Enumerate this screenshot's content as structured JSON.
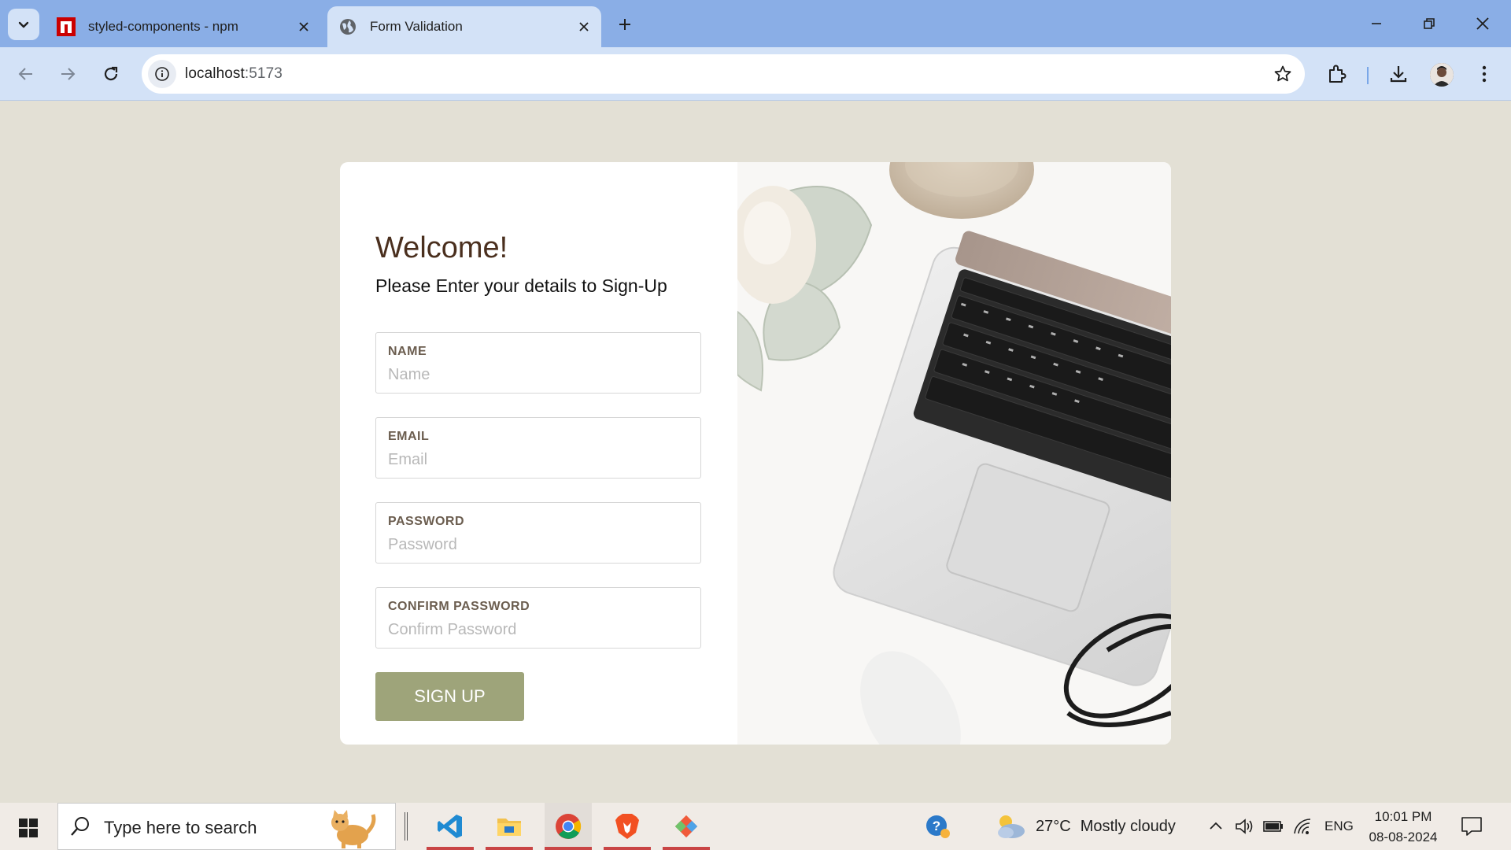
{
  "browser": {
    "tabs": [
      {
        "title": "styled-components - npm",
        "icon": "npm-icon",
        "active": false
      },
      {
        "title": "Form Validation",
        "icon": "globe-icon",
        "active": true
      }
    ],
    "url_host": "localhost",
    "url_port": ":5173"
  },
  "page": {
    "heading": "Welcome!",
    "subheading": "Please Enter your details to Sign-Up",
    "fields": [
      {
        "label": "NAME",
        "placeholder": "Name"
      },
      {
        "label": "EMAIL",
        "placeholder": "Email"
      },
      {
        "label": "PASSWORD",
        "placeholder": "Password"
      },
      {
        "label": "CONFIRM PASSWORD",
        "placeholder": "Confirm Password"
      }
    ],
    "submit_label": "SIGN UP",
    "colors": {
      "background": "#e3e0d5",
      "heading": "#4a2f1e",
      "button": "#9ea47a"
    }
  },
  "taskbar": {
    "search_placeholder": "Type here to search",
    "weather": {
      "temp": "27°C",
      "condition": "Mostly cloudy"
    },
    "language": "ENG",
    "time": "10:01 PM",
    "date": "08-08-2024",
    "apps": [
      "vscode-icon",
      "file-explorer-icon",
      "chrome-icon",
      "brave-icon",
      "git-icon"
    ]
  }
}
